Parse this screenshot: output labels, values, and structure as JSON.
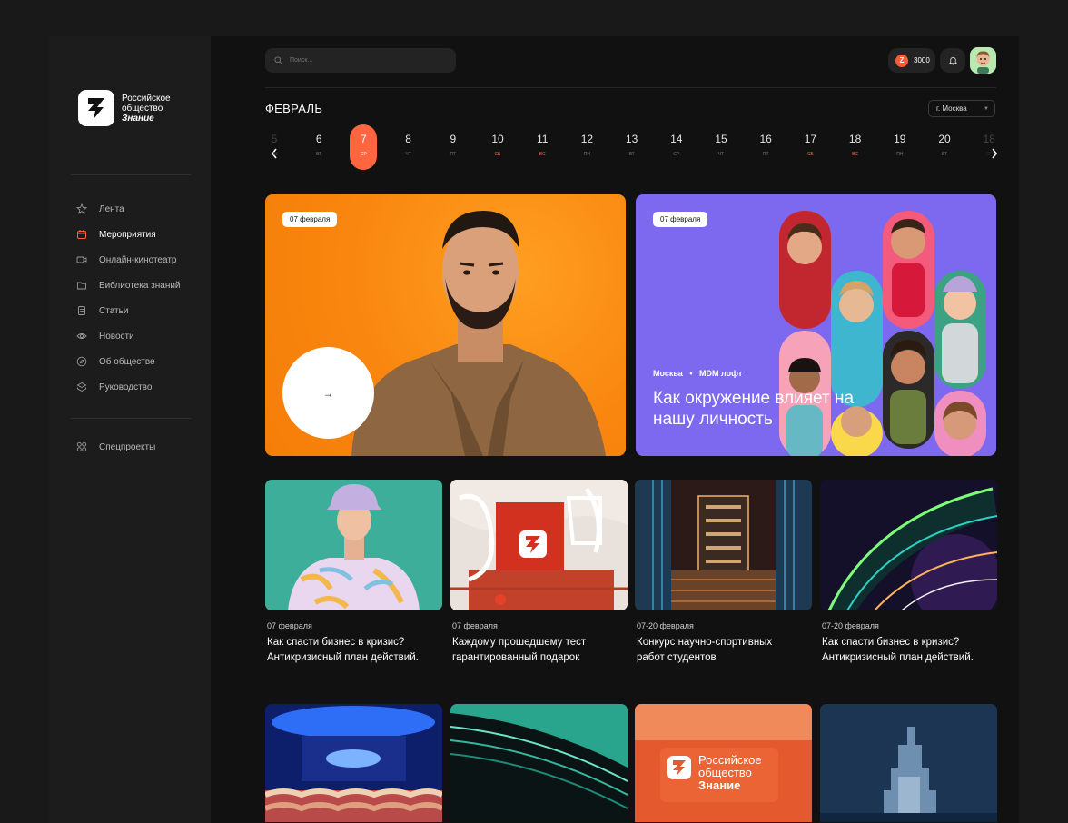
{
  "brand": {
    "line1": "Российское",
    "line2": "общество",
    "line3": "Знание"
  },
  "sidebar": {
    "items": [
      {
        "label": "Лента",
        "icon": "star-icon",
        "active": false
      },
      {
        "label": "Мероприятия",
        "icon": "calendar-icon",
        "active": true
      },
      {
        "label": "Онлайн-кинотеатр",
        "icon": "video-icon",
        "active": false
      },
      {
        "label": "Библиотека знаний",
        "icon": "folder-icon",
        "active": false
      },
      {
        "label": "Статьи",
        "icon": "document-icon",
        "active": false
      },
      {
        "label": "Новости",
        "icon": "eye-icon",
        "active": false
      },
      {
        "label": "Об обществе",
        "icon": "compass-icon",
        "active": false
      },
      {
        "label": "Руководство",
        "icon": "stack-icon",
        "active": false
      }
    ],
    "special": {
      "label": "Спецпроекты",
      "icon": "grid-icon"
    }
  },
  "header": {
    "search_placeholder": "Поиск...",
    "coins": "3000",
    "coin_glyph": "Z"
  },
  "calendar": {
    "month": "ФЕВРАЛЬ",
    "city": "г. Москва",
    "days": [
      {
        "num": "5",
        "wd": "пн",
        "weekend": false,
        "selected": false,
        "faded": true
      },
      {
        "num": "6",
        "wd": "вт",
        "weekend": false,
        "selected": false,
        "faded": false
      },
      {
        "num": "7",
        "wd": "ср",
        "weekend": false,
        "selected": true,
        "faded": false
      },
      {
        "num": "8",
        "wd": "чт",
        "weekend": false,
        "selected": false,
        "faded": false
      },
      {
        "num": "9",
        "wd": "пт",
        "weekend": false,
        "selected": false,
        "faded": false
      },
      {
        "num": "10",
        "wd": "сб",
        "weekend": true,
        "selected": false,
        "faded": false
      },
      {
        "num": "11",
        "wd": "вс",
        "weekend": true,
        "selected": false,
        "faded": false
      },
      {
        "num": "12",
        "wd": "пн",
        "weekend": false,
        "selected": false,
        "faded": false
      },
      {
        "num": "13",
        "wd": "вт",
        "weekend": false,
        "selected": false,
        "faded": false
      },
      {
        "num": "14",
        "wd": "ср",
        "weekend": false,
        "selected": false,
        "faded": false
      },
      {
        "num": "15",
        "wd": "чт",
        "weekend": false,
        "selected": false,
        "faded": false
      },
      {
        "num": "16",
        "wd": "пт",
        "weekend": false,
        "selected": false,
        "faded": false
      },
      {
        "num": "17",
        "wd": "сб",
        "weekend": true,
        "selected": false,
        "faded": false
      },
      {
        "num": "18",
        "wd": "вс",
        "weekend": true,
        "selected": false,
        "faded": false
      },
      {
        "num": "19",
        "wd": "пн",
        "weekend": false,
        "selected": false,
        "faded": false
      },
      {
        "num": "20",
        "wd": "вт",
        "weekend": false,
        "selected": false,
        "faded": false
      },
      {
        "num": "18",
        "wd": "ср",
        "weekend": false,
        "selected": false,
        "faded": true
      }
    ]
  },
  "hero": {
    "left": {
      "date": "07 февраля",
      "arrow": "→"
    },
    "right": {
      "date": "07 февраля",
      "location": "Москва",
      "venue": "MDM лофт",
      "title": "Как окружение влияет на нашу личность"
    }
  },
  "cards": [
    {
      "date": "07 февраля",
      "title": "Как спасти бизнес в кризис? Антикризисный план действий."
    },
    {
      "date": "07 февраля",
      "title": "Каждому прошедшему тест гарантированный подарок"
    },
    {
      "date": "07-20 февраля",
      "title": "Конкурс научно-спортивных работ студентов"
    },
    {
      "date": "07-20 февраля",
      "title": "Как спасти бизнес в кризис? Антикризисный план действий."
    }
  ],
  "card3_logo": {
    "line1": "Российское",
    "line2": "общество",
    "line3": "Знание"
  },
  "colors": {
    "accent": "#ff6640",
    "bg": "#111111",
    "sidebar": "#1c1c1c",
    "purple": "#7d68f0",
    "orange": "#f9860e"
  }
}
